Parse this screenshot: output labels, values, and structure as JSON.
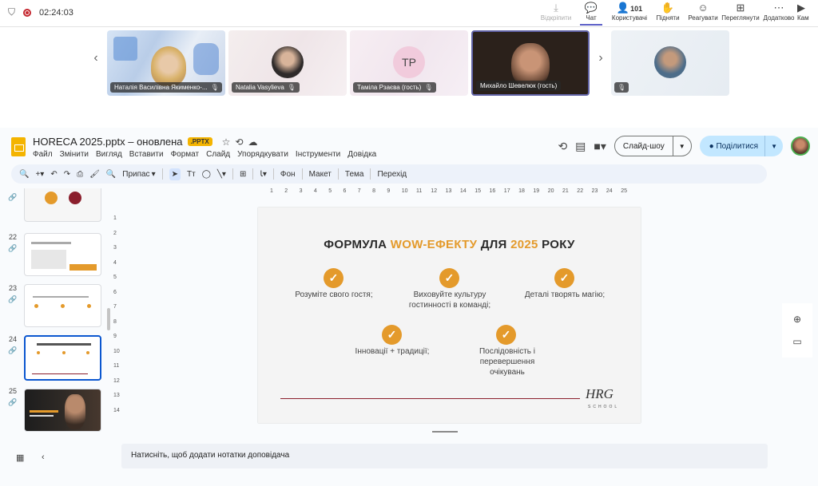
{
  "teams": {
    "timer": "02:24:03",
    "actions": [
      {
        "label": "Відкріпити",
        "icon": "⤓",
        "dim": true
      },
      {
        "label": "Чат",
        "icon": "💬",
        "selected": true
      },
      {
        "label": "Користувачі",
        "icon": "👤",
        "count": "101"
      },
      {
        "label": "Підняти",
        "icon": "✋"
      },
      {
        "label": "Реагувати",
        "icon": "☺"
      },
      {
        "label": "Переглянути",
        "icon": "⊞"
      },
      {
        "label": "Додатково",
        "icon": "⋯"
      },
      {
        "label": "Кам",
        "icon": "▶"
      }
    ],
    "participants": [
      {
        "name": "Наталія Василівна Якименко-...",
        "initials": ""
      },
      {
        "name": "Natalia Vasylieva",
        "initials": ""
      },
      {
        "name": "Таміла Рзаєва (гость)",
        "initials": "TP"
      },
      {
        "name": "Михайло Шевелюк (гость)",
        "initials": ""
      },
      {
        "name": "",
        "initials": ""
      }
    ]
  },
  "slides": {
    "doc_title": "HORECA 2025.pptx – оновлена",
    "file_badge": ".PPTX",
    "menu": [
      "Файл",
      "Змінити",
      "Вигляд",
      "Вставити",
      "Формат",
      "Слайд",
      "Упорядкувати",
      "Інструменти",
      "Довідка"
    ],
    "slideshow_label": "Слайд-шоу",
    "share_label": "Поділитися",
    "toolbar": {
      "fit_label": "Припас",
      "background": "Фон",
      "layout": "Макет",
      "theme": "Тема",
      "transition": "Перехід"
    },
    "filmstrip": [
      {
        "num": "",
        "label": ""
      },
      {
        "num": "22",
        "label": ""
      },
      {
        "num": "23",
        "label": ""
      },
      {
        "num": "24",
        "label": "",
        "selected": true
      },
      {
        "num": "25",
        "label": ""
      }
    ],
    "ruler_h": [
      "1",
      "2",
      "3",
      "4",
      "5",
      "6",
      "7",
      "8",
      "9",
      "10",
      "11",
      "12",
      "13",
      "14",
      "15",
      "16",
      "17",
      "18",
      "19",
      "20",
      "21",
      "22",
      "23",
      "24",
      "25"
    ],
    "ruler_v": [
      "1",
      "2",
      "3",
      "4",
      "5",
      "6",
      "7",
      "8",
      "9",
      "10",
      "11",
      "12",
      "13",
      "14"
    ],
    "slide": {
      "title_part1": "ФОРМУЛА ",
      "title_accent1": "WOW-ЕФЕКТУ",
      "title_part2": " ДЛЯ ",
      "title_accent2": "2025",
      "title_part3": " РОКУ",
      "items": [
        "Розуміте свого гостя;",
        "Виховуйте культуру гостинності в команді;",
        "Деталі творять магію;",
        "Інновації + традиції;",
        "Послідовність і перевершення очікувань"
      ],
      "logo": "HRG",
      "logo_sub": "SCHOOL",
      "accent_color": "#e49a2b"
    },
    "notes_placeholder": "Натисніть, щоб додати нотатки доповідача"
  }
}
